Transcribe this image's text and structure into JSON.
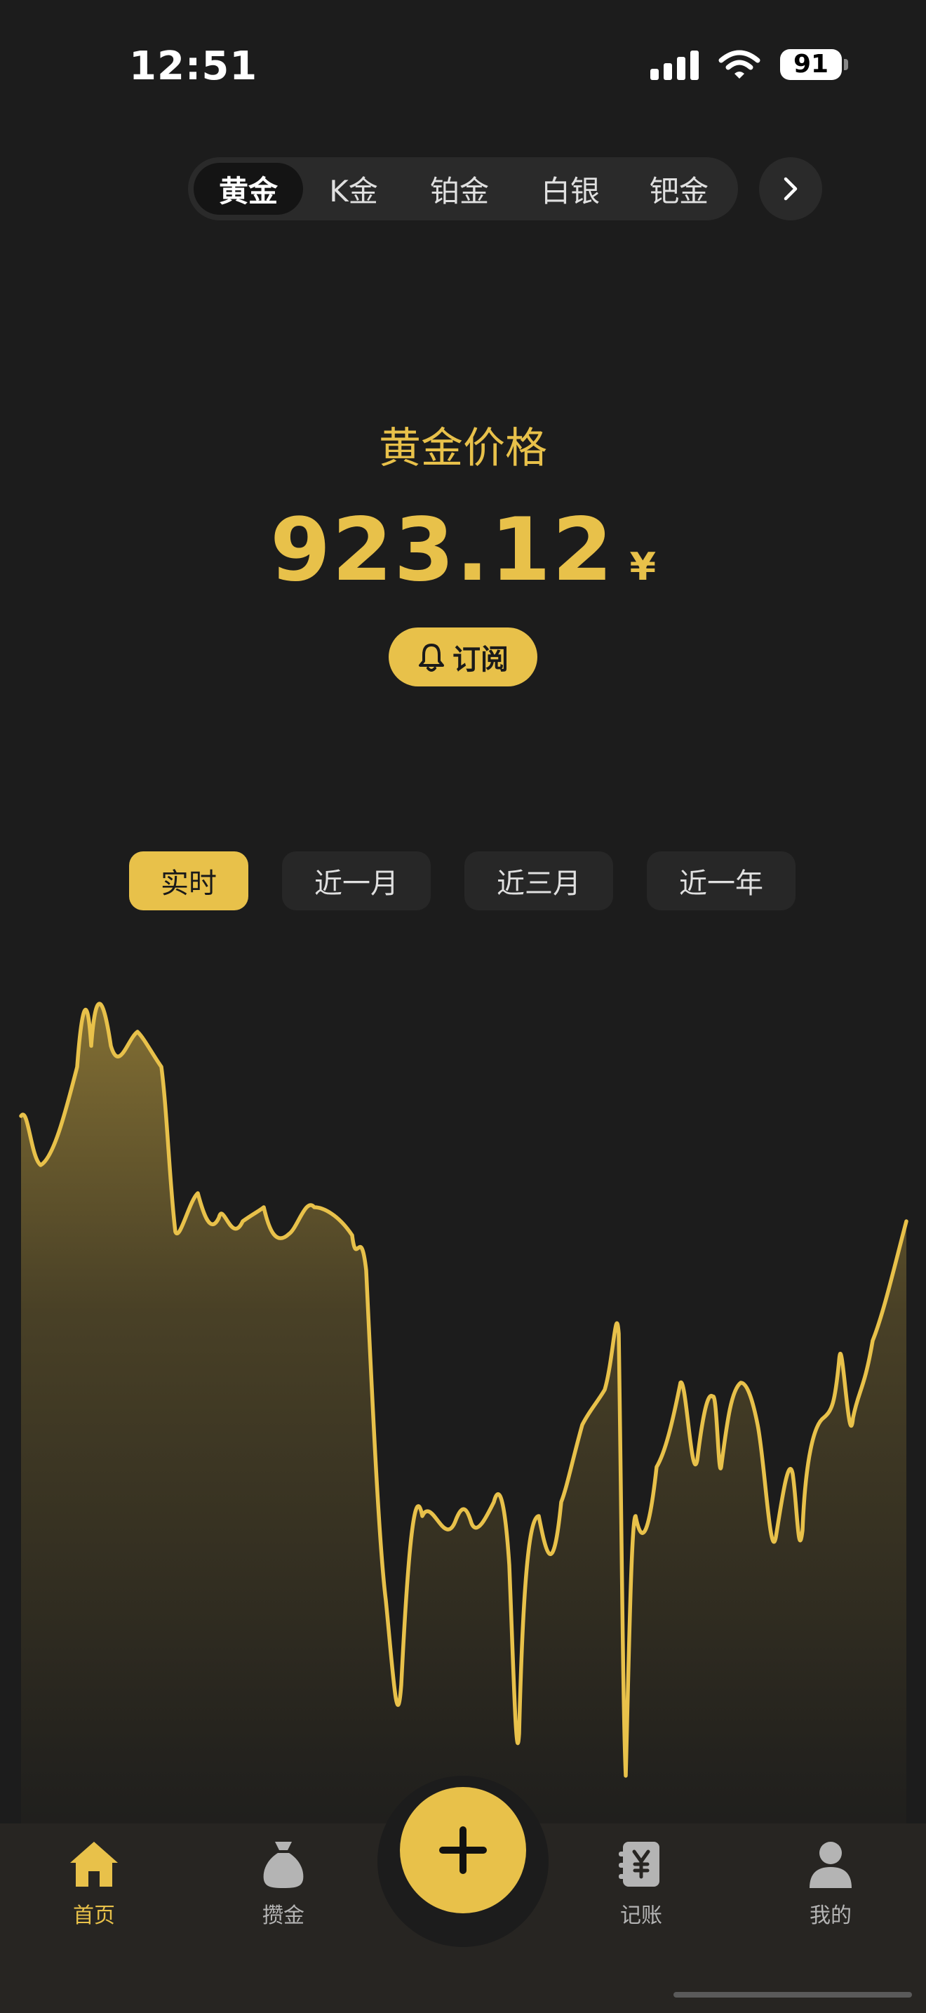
{
  "status_bar": {
    "time": "12:51",
    "battery": "91"
  },
  "metal_tabs": [
    {
      "label": "黄金",
      "active": true
    },
    {
      "label": "K金",
      "active": false
    },
    {
      "label": "铂金",
      "active": false
    },
    {
      "label": "白银",
      "active": false
    },
    {
      "label": "钯金",
      "active": false
    }
  ],
  "price": {
    "title": "黄金价格",
    "value": "923.12",
    "currency": "¥"
  },
  "subscribe": {
    "label": "订阅"
  },
  "range_tabs": [
    {
      "label": "实时",
      "active": true
    },
    {
      "label": "近一月",
      "active": false
    },
    {
      "label": "近三月",
      "active": false
    },
    {
      "label": "近一年",
      "active": false
    }
  ],
  "colors": {
    "accent": "#e8c14a",
    "background": "#1c1c1c",
    "tab_bg": "#2a2a2a",
    "nav_bg": "#272522"
  },
  "bottom_nav": [
    {
      "label": "首页",
      "icon": "home-icon",
      "active": true
    },
    {
      "label": "攒金",
      "icon": "money-bag-icon",
      "active": false
    },
    {
      "label": "记账",
      "icon": "ledger-icon",
      "active": false
    },
    {
      "label": "我的",
      "icon": "user-icon",
      "active": false
    }
  ],
  "fab_icon": "plus-icon"
}
